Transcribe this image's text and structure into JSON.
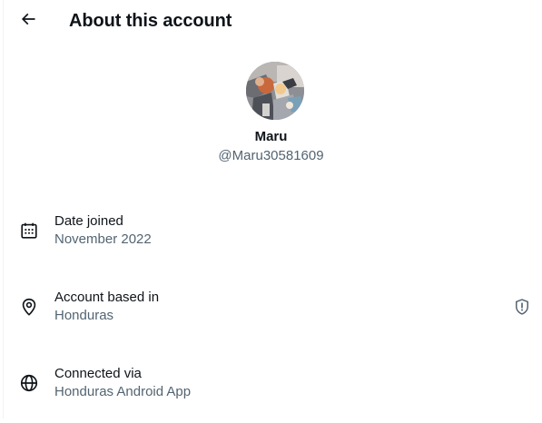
{
  "header": {
    "title": "About this account",
    "back_icon": "arrow-left-icon"
  },
  "profile": {
    "display_name": "Maru",
    "handle": "@Maru30581609"
  },
  "rows": [
    {
      "icon": "calendar-icon",
      "label": "Date joined",
      "value": "November 2022"
    },
    {
      "icon": "location-pin-icon",
      "label": "Account based in",
      "value": "Honduras",
      "badge_icon": "shield-alert-icon"
    },
    {
      "icon": "globe-icon",
      "label": "Connected via",
      "value": "Honduras Android App"
    }
  ],
  "colors": {
    "text": "#0f1419",
    "secondary": "#536471",
    "divider": "#eff3f4",
    "background": "#ffffff"
  }
}
